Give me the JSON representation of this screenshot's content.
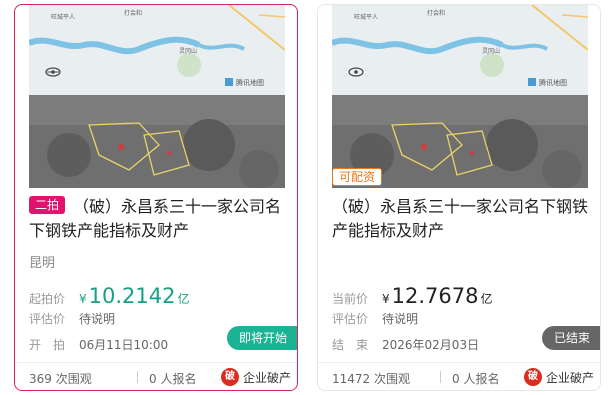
{
  "cards": [
    {
      "round_badge": "二拍",
      "title": "（破）永昌系三十一家公司名下钢铁产能指标及财产",
      "city": "昆明",
      "price_label": "起拍价",
      "currency": "¥",
      "price": "10.2142",
      "unit": "亿",
      "eval_label": "评估价",
      "eval_value": "待说明",
      "time_label": "开　拍",
      "time_value": "06月11日10:00",
      "status": "即将开始",
      "views": "369 次围观",
      "signups": "0 人报名",
      "category_icon": "破",
      "category": "企业破产",
      "map_labels": [
        "旺城平人",
        "打会和",
        "灵冈山",
        "腾讯地图"
      ]
    },
    {
      "tag": "可配资",
      "title": "（破）永昌系三十一家公司名下钢铁产能指标及财产",
      "price_label": "当前价",
      "currency": "¥",
      "price": "12.7678",
      "unit": "亿",
      "eval_label": "评估价",
      "eval_value": "待说明",
      "time_label": "结　束",
      "time_value": "2026年02月03日",
      "status": "已结束",
      "views": "11472 次围观",
      "signups": "0 人报名",
      "category_icon": "破",
      "category": "企业破产",
      "map_labels": [
        "旺城平人",
        "打会和",
        "灵冈山",
        "腾讯地图"
      ]
    }
  ],
  "colors": {
    "accent": "#e2136e",
    "teal": "#16a084",
    "ended": "#666666"
  }
}
